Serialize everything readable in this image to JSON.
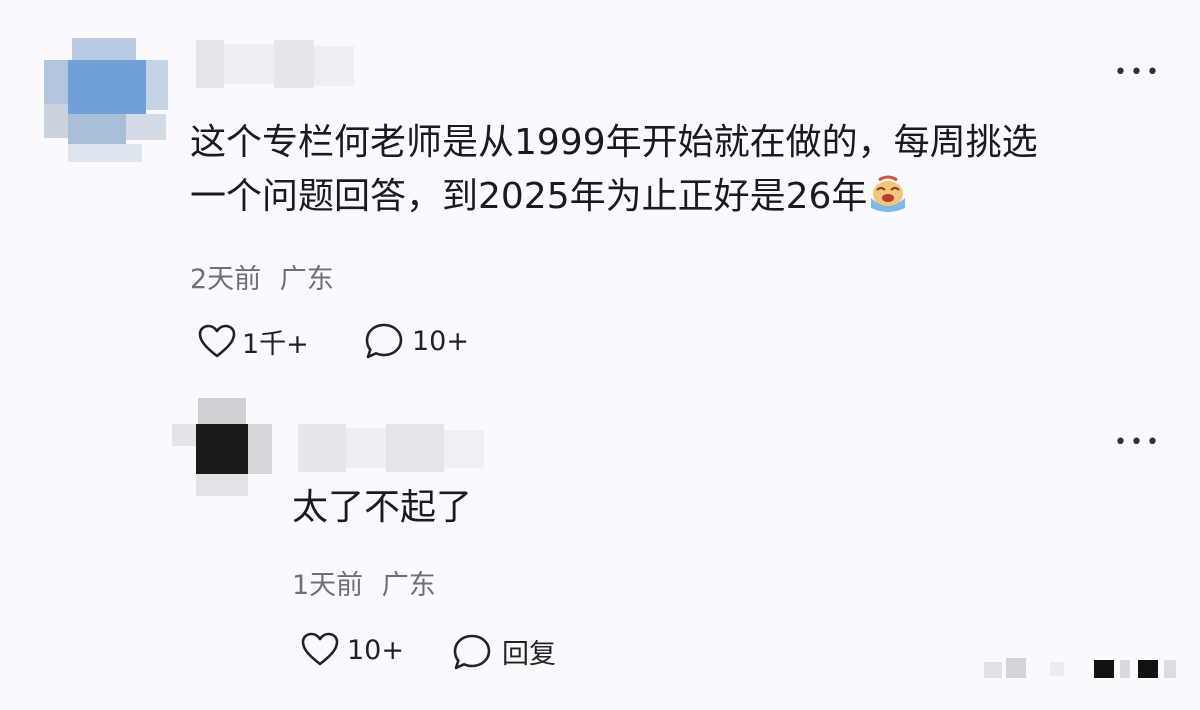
{
  "comment": {
    "text_line1": "这个专栏何老师是从1999年开始就在做的，每周挑选",
    "text_line2": "一个问题回答，到2025年为止正好是26年",
    "emoji_icon": "crying-face-emoji",
    "time": "2天前",
    "location": "广东",
    "likes": "1千+",
    "replies": "10+"
  },
  "reply": {
    "text": "太了不起了",
    "time": "1天前",
    "location": "广东",
    "likes": "10+",
    "reply_label": "回复"
  },
  "colors": {
    "background": "#fafafe",
    "meta": "#6f6f78"
  }
}
